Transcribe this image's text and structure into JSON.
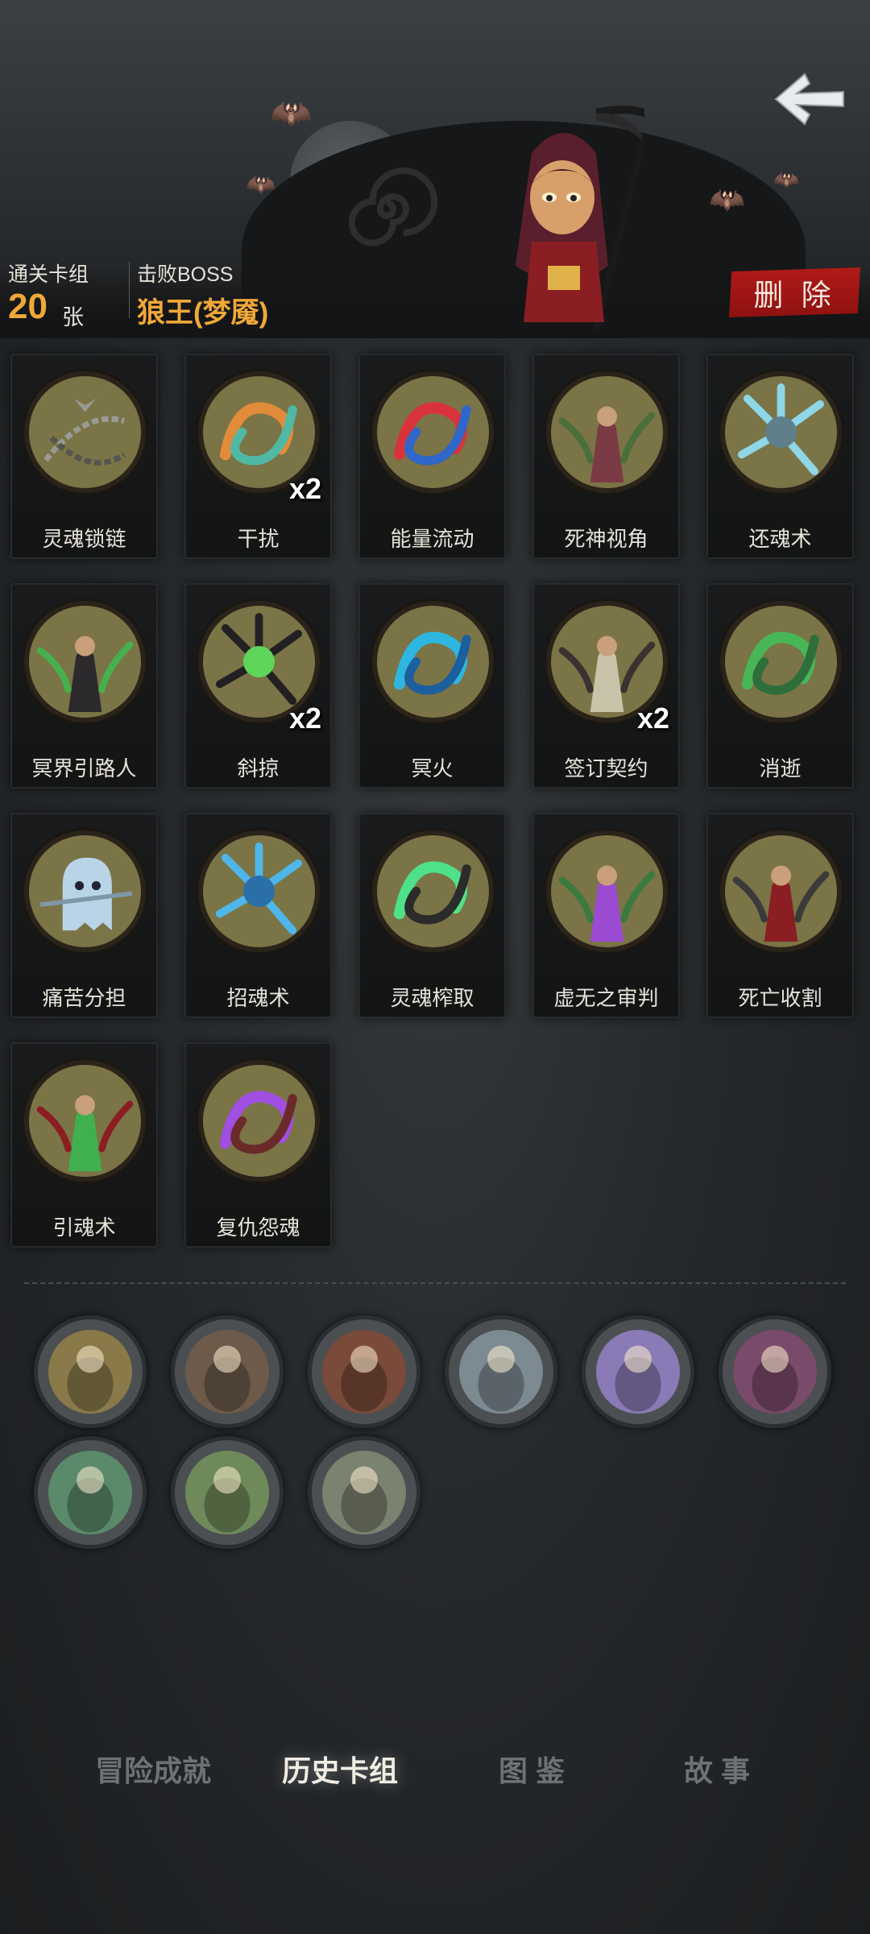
{
  "header": {
    "cleared_deck_label": "通关卡组",
    "card_count": "20",
    "card_unit": "张",
    "defeated_boss_label": "击败BOSS",
    "boss_name": "狼王(梦魇)",
    "delete_label": "删 除",
    "back_icon": "back-arrow-icon"
  },
  "cards": [
    {
      "name": "灵魂锁链",
      "count": "",
      "art": "chain"
    },
    {
      "name": "干扰",
      "count": "x2",
      "art": "music"
    },
    {
      "name": "能量流动",
      "count": "",
      "art": "energy"
    },
    {
      "name": "死神视角",
      "count": "",
      "art": "reaper-view"
    },
    {
      "name": "还魂术",
      "count": "",
      "art": "revive"
    },
    {
      "name": "冥界引路人",
      "count": "",
      "art": "guide"
    },
    {
      "name": "斜掠",
      "count": "x2",
      "art": "slash"
    },
    {
      "name": "冥火",
      "count": "",
      "art": "hellfire"
    },
    {
      "name": "签订契约",
      "count": "x2",
      "art": "contract"
    },
    {
      "name": "消逝",
      "count": "",
      "art": "vanish"
    },
    {
      "name": "痛苦分担",
      "count": "",
      "art": "ghost"
    },
    {
      "name": "招魂术",
      "count": "",
      "art": "summon"
    },
    {
      "name": "灵魂榨取",
      "count": "",
      "art": "extract"
    },
    {
      "name": "虚无之审判",
      "count": "",
      "art": "judgement"
    },
    {
      "name": "死亡收割",
      "count": "",
      "art": "harvest"
    },
    {
      "name": "引魂术",
      "count": "",
      "art": "lure"
    },
    {
      "name": "复仇怨魂",
      "count": "",
      "art": "vengeance"
    }
  ],
  "relics": [
    {
      "icon": "hourglass-icon"
    },
    {
      "icon": "old-man-icon"
    },
    {
      "icon": "bleeding-fist-icon"
    },
    {
      "icon": "cross-skull-icon"
    },
    {
      "icon": "glowing-book-icon"
    },
    {
      "icon": "vampire-icon"
    },
    {
      "icon": "spirit-bed-icon"
    },
    {
      "icon": "ogre-ghost-icon"
    },
    {
      "icon": "gravedigger-icon"
    }
  ],
  "tabs": [
    {
      "label": "冒险成就",
      "active": false
    },
    {
      "label": "历史卡组",
      "active": true
    },
    {
      "label": "图 鉴",
      "active": false
    },
    {
      "label": "故 事",
      "active": false
    }
  ],
  "colors": {
    "accent_orange": "#f0a838",
    "delete_red": "#a8171a",
    "card_art_bg": "#7a7446"
  }
}
